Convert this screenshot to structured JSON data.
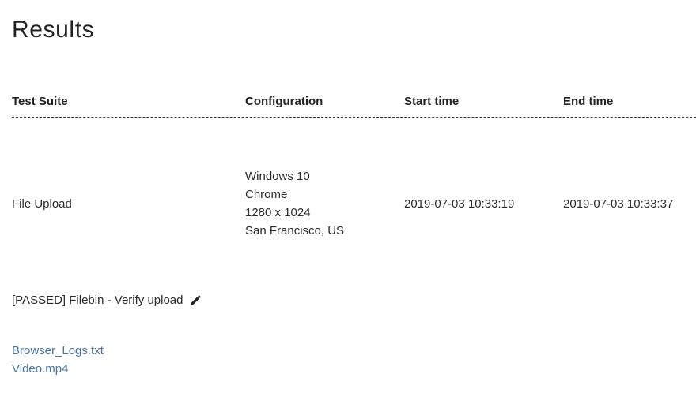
{
  "page": {
    "title": "Results"
  },
  "table": {
    "headers": {
      "suite": "Test Suite",
      "configuration": "Configuration",
      "start_time": "Start time",
      "end_time": "End time"
    },
    "rows": [
      {
        "suite": "File Upload",
        "configuration": {
          "os": "Windows 10",
          "browser": "Chrome",
          "resolution": "1280 x 1024",
          "location": "San Francisco, US"
        },
        "start_time": "2019-07-03 10:33:19",
        "end_time": "2019-07-03 10:33:37"
      }
    ]
  },
  "test_case": {
    "label": "[PASSED] Filebin - Verify upload",
    "edit_icon": "pencil-icon"
  },
  "attachments": [
    {
      "label": "Browser_Logs.txt"
    },
    {
      "label": "Video.mp4"
    }
  ],
  "colors": {
    "link": "#4a74a3",
    "text": "#2b2b2b",
    "divider": "#333333"
  }
}
